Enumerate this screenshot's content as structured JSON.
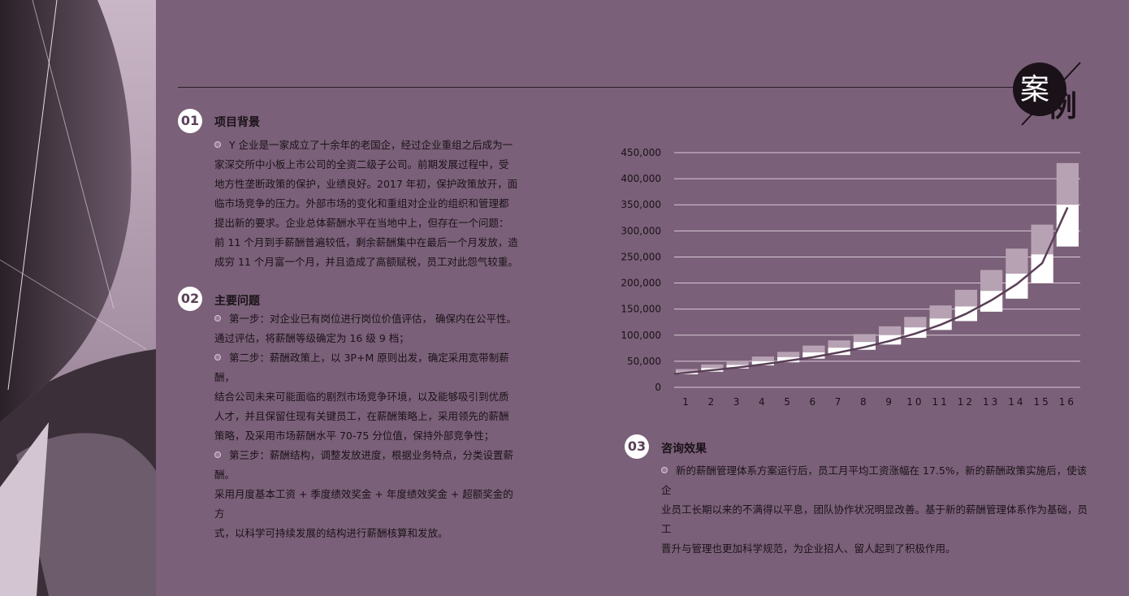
{
  "badge": {
    "text1": "案",
    "text2": "例"
  },
  "sections": [
    {
      "num": "01",
      "title": "项目背景",
      "lines": [
        "Y 企业是一家成立了十余年的老国企，经过企业重组之后成为一",
        "家深交所中小板上市公司的全资二级子公司。前期发展过程中，受",
        "地方性垄断政策的保护，业绩良好。2017 年初，保护政策放开，面",
        "临市场竞争的压力。外部市场的变化和重组对企业的组织和管理都",
        "提出新的要求。企业总体薪酬水平在当地中上，但存在一个问题：",
        "前 11 个月到手薪酬普遍较低，剩余薪酬集中在最后一个月发放，造",
        "成穷 11 个月富一个月，并且造成了高额赋税，员工对此怨气较重。"
      ]
    },
    {
      "num": "02",
      "title": "主要问题",
      "lines": [
        "第一步：对企业已有岗位进行岗位价值评估， 确保内在公平性。",
        "通过评估，将薪酬等级确定为 16 级 9 档；",
        "第二步：薪酬政策上，以 3P+M 原则出发，确定采用宽带制薪酬，",
        "结合公司未来可能面临的剧烈市场竞争环境，以及能够吸引到优质",
        "人才，并且保留住现有关键员工，在薪酬策略上，采用领先的薪酬",
        "策略，及采用市场薪酬水平 70-75 分位值，保持外部竞争性；",
        "第三步：薪酬结构，调整发放进度，根据业务特点，分类设置薪酬。",
        "采用月度基本工资 + 季度绩效奖金 + 年度绩效奖金 + 超额奖金的方",
        "式，以科学可持续发展的结构进行薪酬核算和发放。"
      ]
    },
    {
      "num": "03",
      "title": "咨询效果",
      "lines": [
        "新的薪酬管理体系方案运行后，员工月平均工资涨幅在 17.5%，新的薪酬政策实施后，使该企",
        "业员工长期以来的不满得以平息，团队协作状况明显改善。基于新的薪酬管理体系作为基础，员工",
        "晋升与管理也更加科学规范，为企业招人、留人起到了积极作用。"
      ]
    }
  ],
  "chart_data": {
    "type": "bar",
    "categories": [
      "1",
      "2",
      "3",
      "4",
      "5",
      "6",
      "7",
      "8",
      "9",
      "10",
      "11",
      "12",
      "13",
      "14",
      "15",
      "16"
    ],
    "y_tick_labels": [
      "0",
      "50,000",
      "100,000",
      "150,000",
      "200,000",
      "250,000",
      "300,000",
      "350,000",
      "400,000",
      "450,000"
    ],
    "ylim": [
      0,
      450000
    ],
    "series": [
      {
        "lows": [
          25000,
          30000,
          36000,
          42000,
          48000,
          55000,
          62000,
          72000,
          82000,
          95000,
          110000,
          127000,
          145000,
          170000,
          200000,
          270000
        ],
        "mids": [
          30000,
          37000,
          43000,
          50000,
          58000,
          67000,
          76000,
          87000,
          100000,
          115000,
          132000,
          155000,
          185000,
          218000,
          255000,
          350000
        ],
        "highs": [
          35000,
          44000,
          51000,
          59000,
          68000,
          80000,
          90000,
          102000,
          117000,
          135000,
          157000,
          187000,
          225000,
          266000,
          312000,
          430000
        ]
      }
    ],
    "trend_line": [
      28000,
      33000,
      38000,
      44000,
      51000,
      58000,
      67000,
      77000,
      89000,
      103000,
      120000,
      141000,
      167000,
      198000,
      238000,
      345000
    ],
    "colors": {
      "upper": "#b7a2b4",
      "lower": "#ffffff",
      "line": "#5a3f57",
      "grid": "#d8c9d6"
    },
    "grid": true
  }
}
